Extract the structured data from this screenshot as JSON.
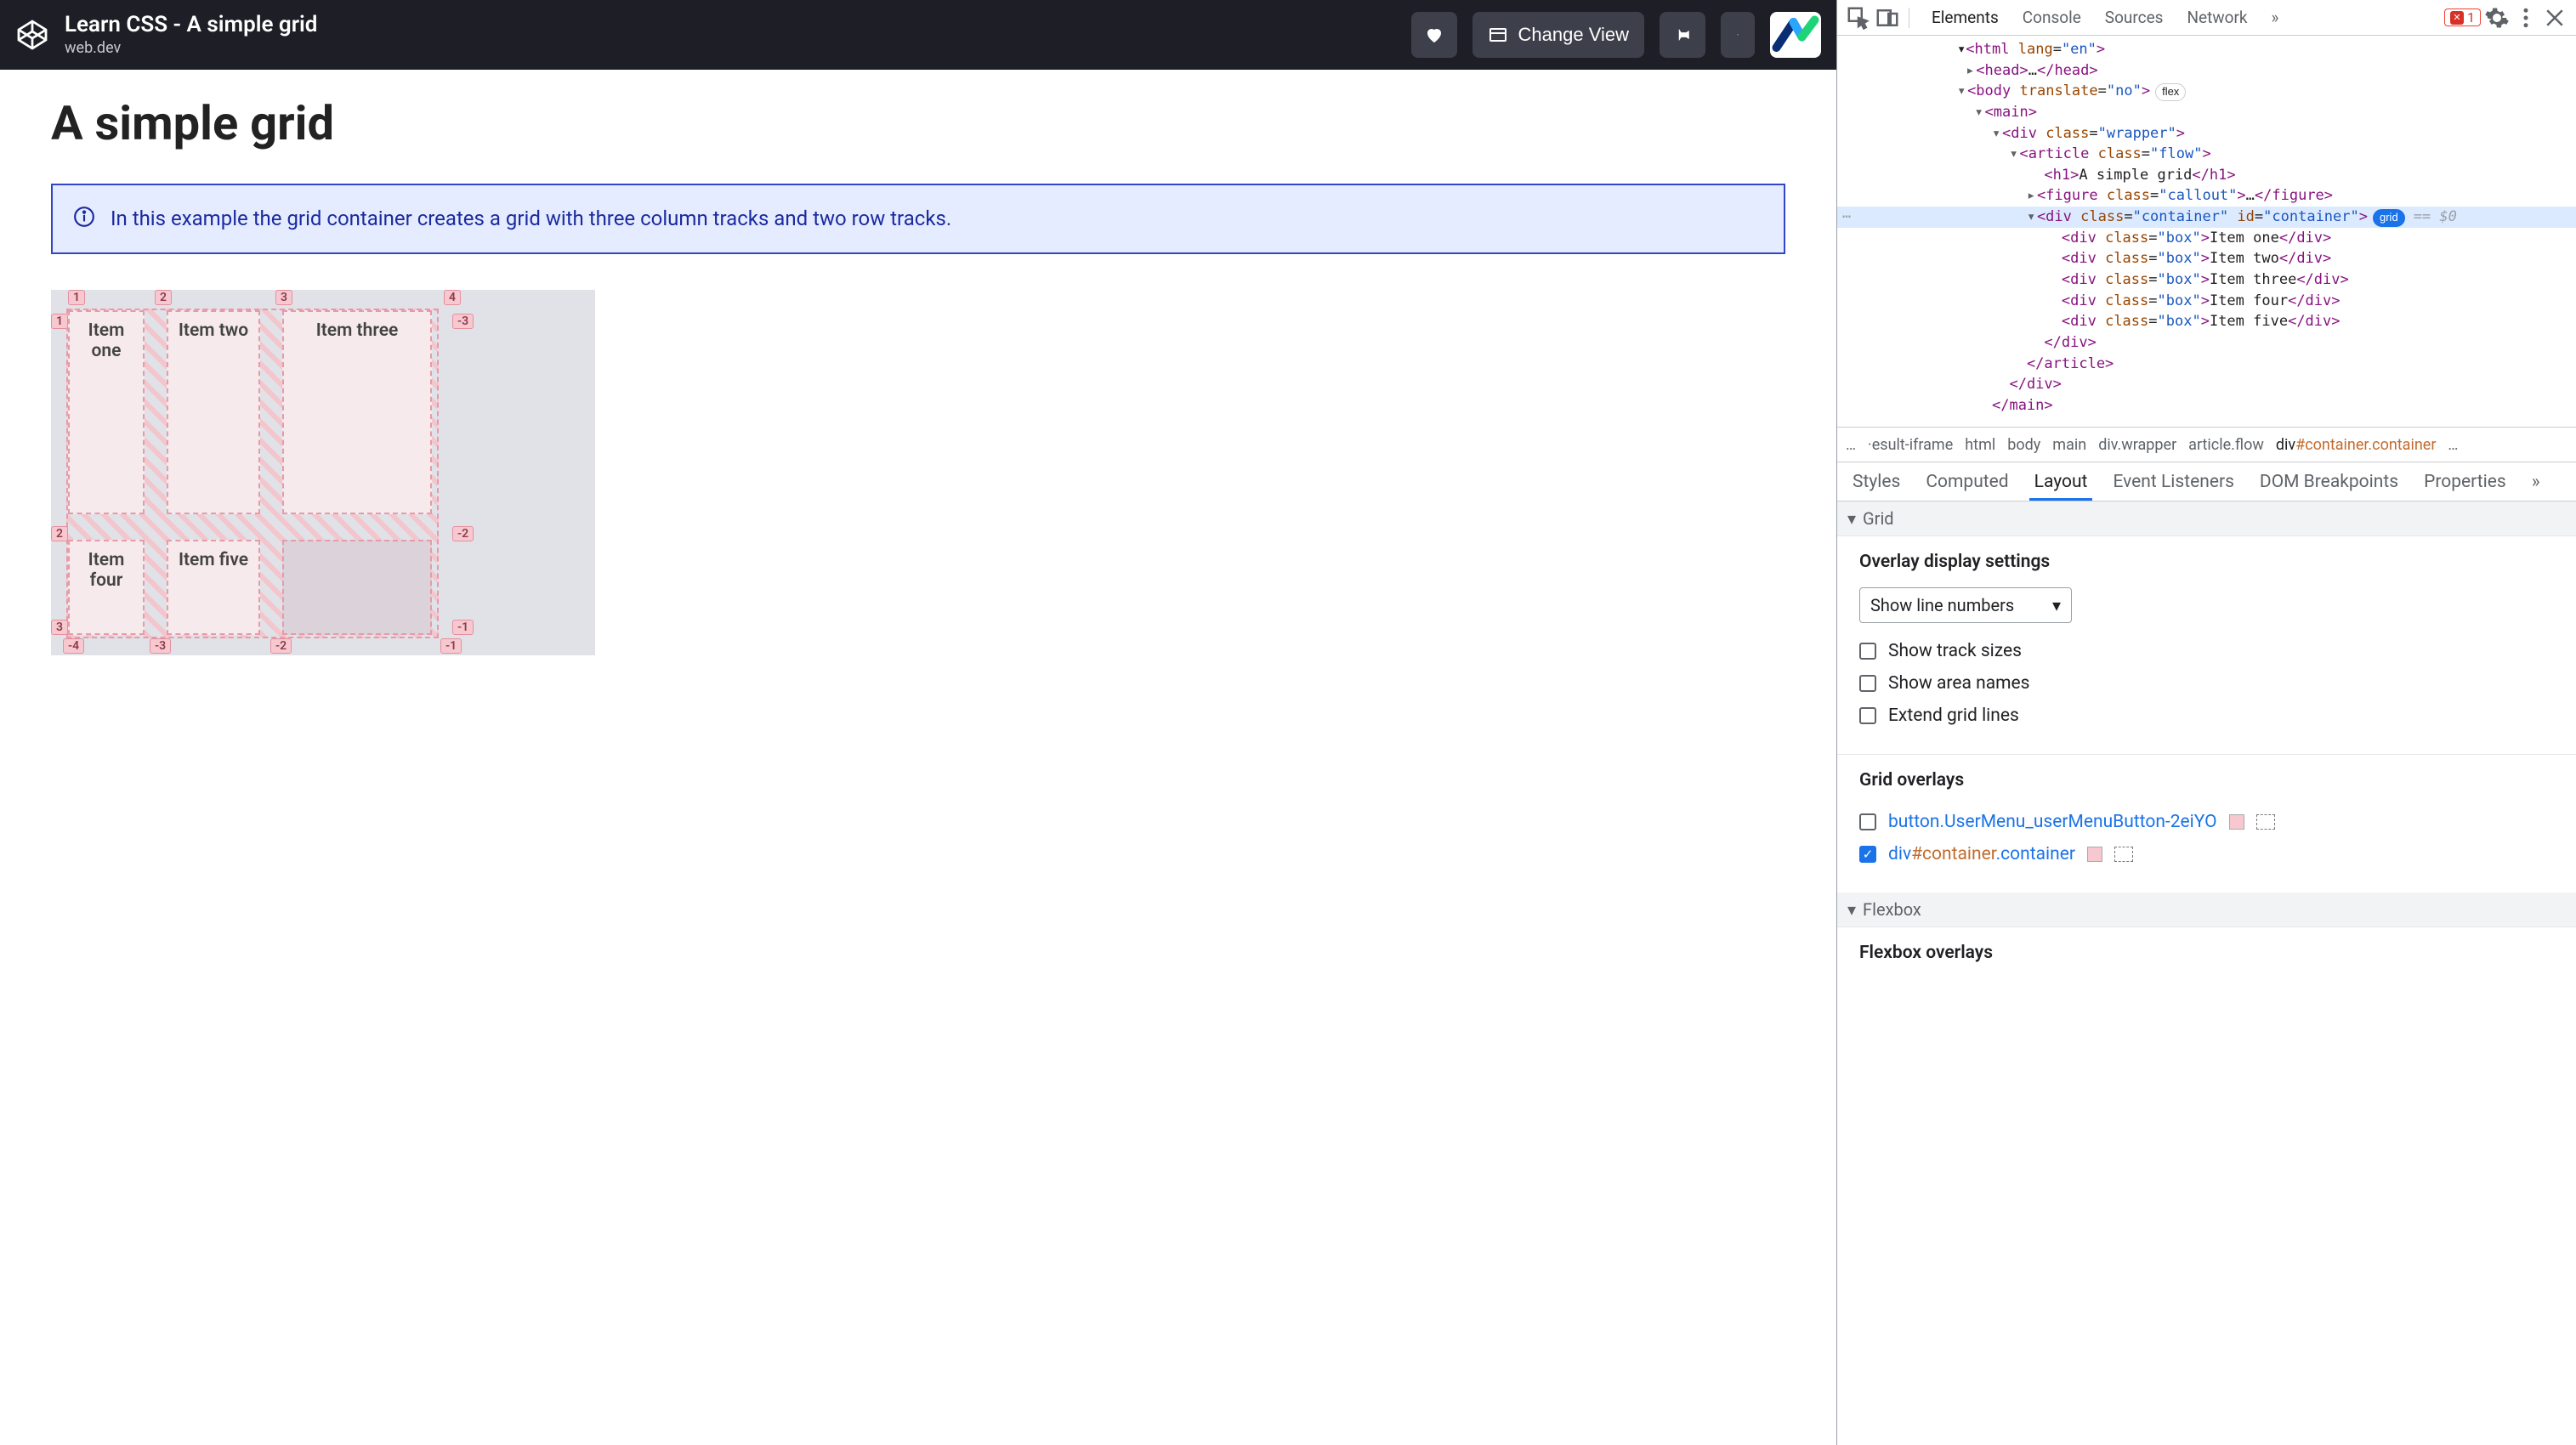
{
  "topbar": {
    "title": "Learn CSS - A simple grid",
    "subtitle": "web.dev",
    "changeView": "Change View"
  },
  "page": {
    "heading": "A simple grid",
    "callout": "In this example the grid container creates a grid with three column tracks and two row tracks."
  },
  "grid": {
    "items": [
      "Item one",
      "Item two",
      "Item three",
      "Item four",
      "Item five"
    ],
    "colsTop": [
      "1",
      "2",
      "3",
      "4"
    ],
    "colsBottom": [
      "-4",
      "-3",
      "-2",
      "-1"
    ],
    "rowsLeft": [
      "1",
      "2",
      "3"
    ],
    "rowsRight": [
      "-3",
      "-2",
      "-1"
    ]
  },
  "dom": {
    "htmlLine": "<html lang=\"en\">",
    "headLine": "<head>…</head>",
    "body": {
      "tag": "body",
      "attr": "translate",
      "val": "no",
      "badge": "flex"
    },
    "main": "main",
    "wrapper": {
      "tag": "div",
      "cls": "wrapper"
    },
    "article": {
      "tag": "article",
      "cls": "flow"
    },
    "h1": "A simple grid",
    "figure": {
      "tag": "figure",
      "cls": "callout",
      "ell": "…"
    },
    "container": {
      "tag": "div",
      "cls": "container",
      "id": "container",
      "badge": "grid",
      "eq": "== $0"
    },
    "boxes": [
      "Item one",
      "Item two",
      "Item three",
      "Item four",
      "Item five"
    ],
    "closeDiv": "</div>",
    "closeArticle": "</article>",
    "closeWrapper": "</div>",
    "closeMain": "</main>"
  },
  "devtools": {
    "tabs": [
      "Elements",
      "Console",
      "Sources",
      "Network"
    ],
    "errorCount": "1",
    "breadcrumb": [
      "…",
      "·esult-iframe",
      "html",
      "body",
      "main",
      "div.wrapper",
      "article.flow"
    ],
    "breadcrumbActive": {
      "a": "div",
      "b": "#container",
      "c": ".container"
    },
    "subTabs": [
      "Styles",
      "Computed",
      "Layout",
      "Event Listeners",
      "DOM Breakpoints",
      "Properties"
    ]
  },
  "layout": {
    "gridHdr": "Grid",
    "overlayTitle": "Overlay display settings",
    "selectLabel": "Show line numbers",
    "checks": [
      "Show track sizes",
      "Show area names",
      "Extend grid lines"
    ],
    "gridOverlaysTitle": "Grid overlays",
    "overlays": [
      {
        "label": "button.UserMenu_userMenuButton-2eiYO",
        "checked": false
      },
      {
        "label": "div#container.container",
        "checked": true
      }
    ],
    "flexHdr": "Flexbox",
    "flexOverlaysTitle": "Flexbox overlays"
  }
}
